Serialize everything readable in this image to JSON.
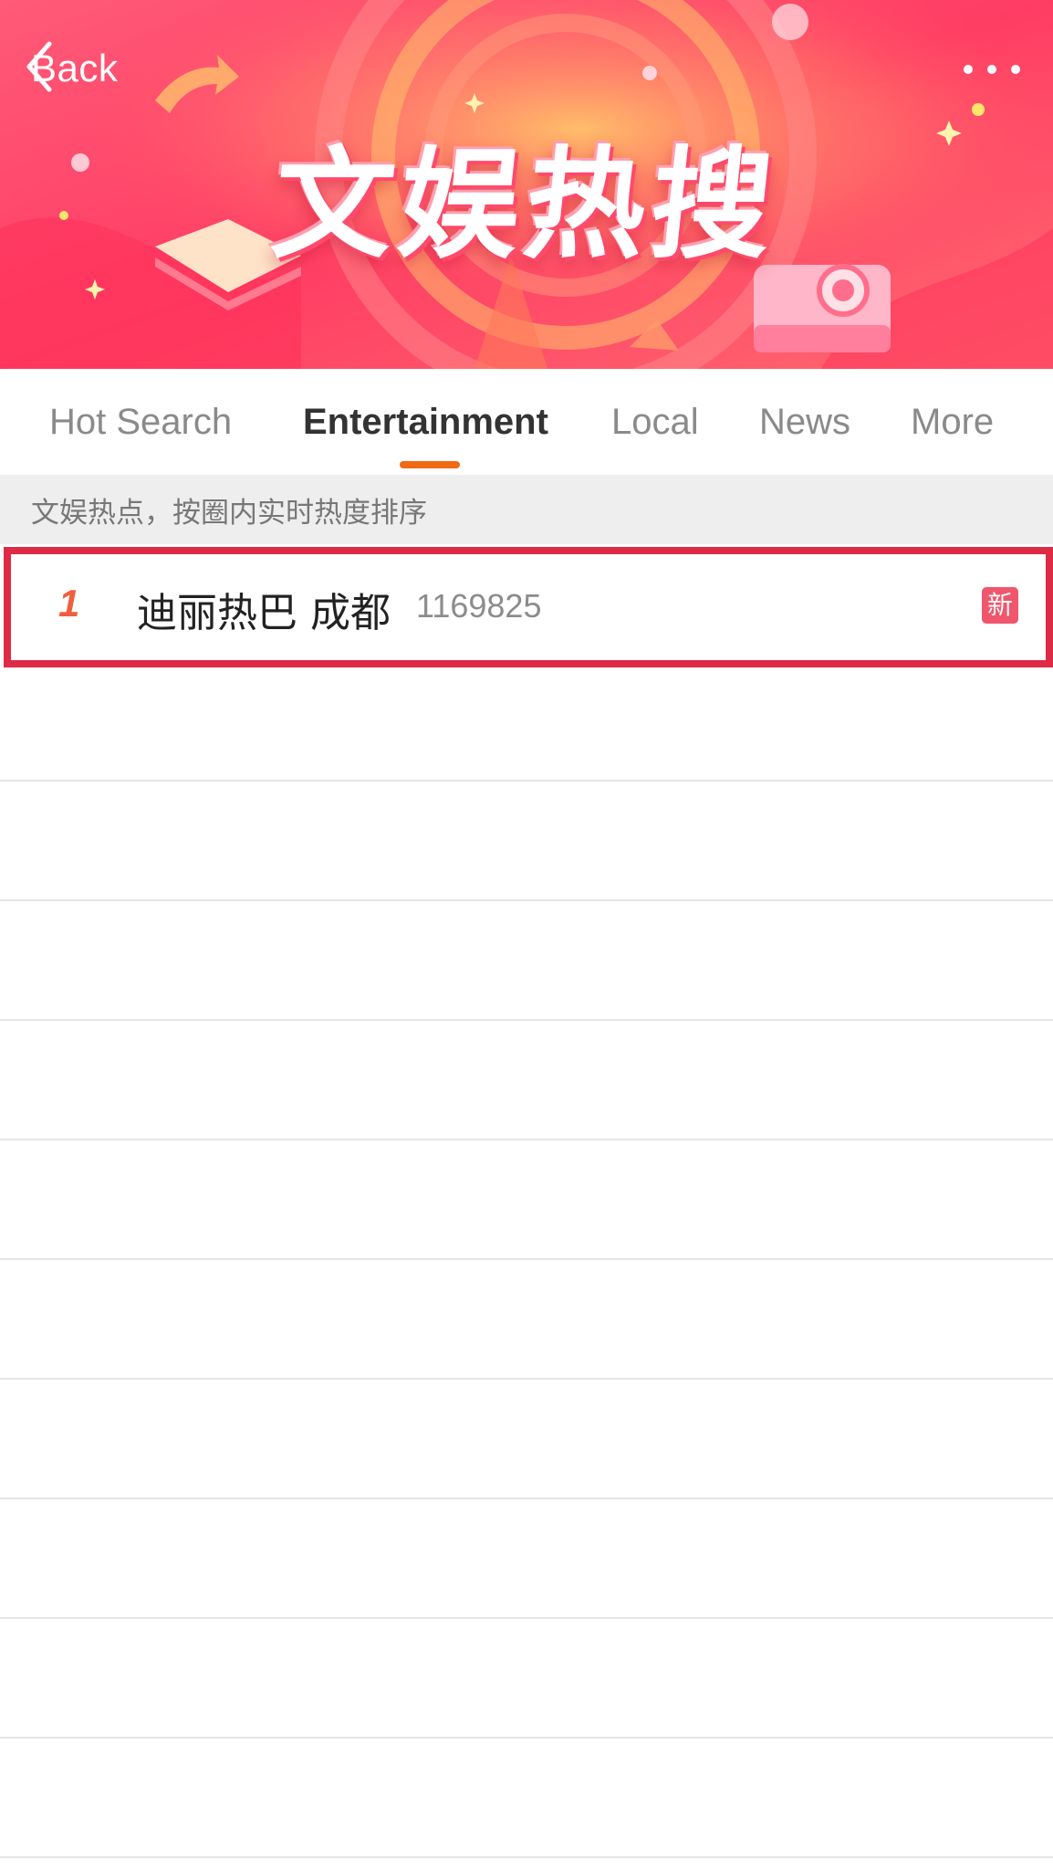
{
  "header": {
    "back_label": "Back",
    "banner_title": "文娱热搜",
    "more_icon": "ellipsis-icon"
  },
  "tabs": [
    {
      "label": "Hot Search",
      "active": false
    },
    {
      "label": "Entertainment",
      "active": true
    },
    {
      "label": "Local",
      "active": false
    },
    {
      "label": "News",
      "active": false
    },
    {
      "label": "More",
      "active": false
    }
  ],
  "subheader": {
    "text": "文娱热点，按圈内实时热度排序"
  },
  "list": {
    "items": [
      {
        "rank": "1",
        "title": "迪丽热巴 成都",
        "heat": "1169825",
        "badge": "新"
      }
    ]
  },
  "colors": {
    "accent": "#ef6a12",
    "highlight_border": "#de2a45",
    "badge": "#f0566c",
    "rank": "#f15e3d"
  }
}
